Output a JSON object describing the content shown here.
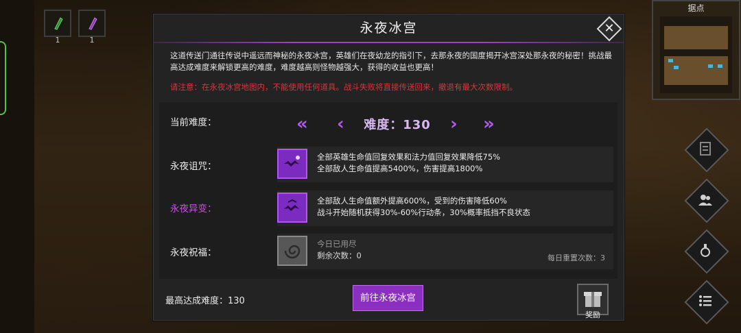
{
  "top_left_items": [
    {
      "count": "1",
      "color": "#2e8b38"
    },
    {
      "count": "1",
      "color": "#8a3ab0"
    }
  ],
  "minimap": {
    "title": "据点"
  },
  "dialog": {
    "title": "永夜冰宫",
    "description": "这道传送门通往传说中遥远而神秘的永夜冰宫，英雄们在夜幼龙的指引下，去那永夜的国度揭开冰宫深处那永夜的秘密！挑战最高达成难度来解锁更高的难度，难度越高则怪物越强大，获得的收益也更高！",
    "warning": "请注意：在永夜冰宫地图内，不能使用任何道具。战斗失败将直接传送回来，撤退有最大次数限制。",
    "current_difficulty_label": "当前难度：",
    "difficulty_display": "难度：130",
    "curse": {
      "label": "永夜诅咒：",
      "line1": "全部英雄生命值回复效果和法力值回复效果降低75%",
      "line2": "全部敌人生命值提高5400%，伤害提高1800%"
    },
    "mutation": {
      "label": "永夜异变：",
      "line1": "全部敌人生命值额外提高600%，受到的伤害降低60%",
      "line2": "战斗开始随机获得30%-60%行动条，30%概率抵挡不良状态"
    },
    "blessing": {
      "label": "永夜祝福：",
      "line1": "今日已用尽",
      "line2": "剩余次数：0",
      "reset": "每日重置次数：3"
    },
    "max_difficulty": "最高达成难度：130",
    "go_button": "前往永夜冰宫",
    "reward_label": "奖励"
  },
  "colors": {
    "accent": "#8a2fc0",
    "warning": "#e0323a",
    "highlight": "#c455e0"
  }
}
